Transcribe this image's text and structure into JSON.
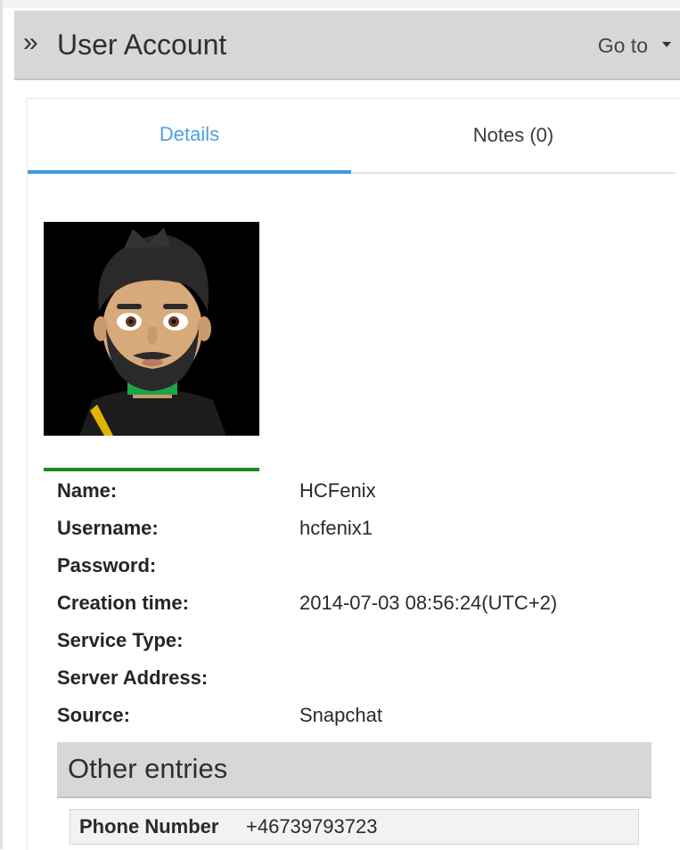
{
  "header": {
    "title": "User Account",
    "goto_label": "Go to"
  },
  "tabs": [
    {
      "label": "Details"
    },
    {
      "label": "Notes (0)"
    }
  ],
  "fields": [
    {
      "label": "Name:",
      "value": "HCFenix"
    },
    {
      "label": "Username:",
      "value": "hcfenix1"
    },
    {
      "label": "Password:",
      "value": ""
    },
    {
      "label": "Creation time:",
      "value": "2014-07-03 08:56:24(UTC+2)"
    },
    {
      "label": "Service Type:",
      "value": ""
    },
    {
      "label": "Server Address:",
      "value": ""
    },
    {
      "label": "Source:",
      "value": "Snapchat"
    }
  ],
  "other_entries": {
    "title": "Other entries",
    "rows": [
      {
        "key": "Phone Number",
        "value": "+46739793723"
      }
    ]
  },
  "colors": {
    "active_tab": "#3c9ae0",
    "avatar_underline": "#198a1e",
    "header_bg": "#d7d7d7"
  },
  "icons": {
    "expand": "double-chevron-right-icon",
    "dropdown": "caret-down-icon"
  }
}
